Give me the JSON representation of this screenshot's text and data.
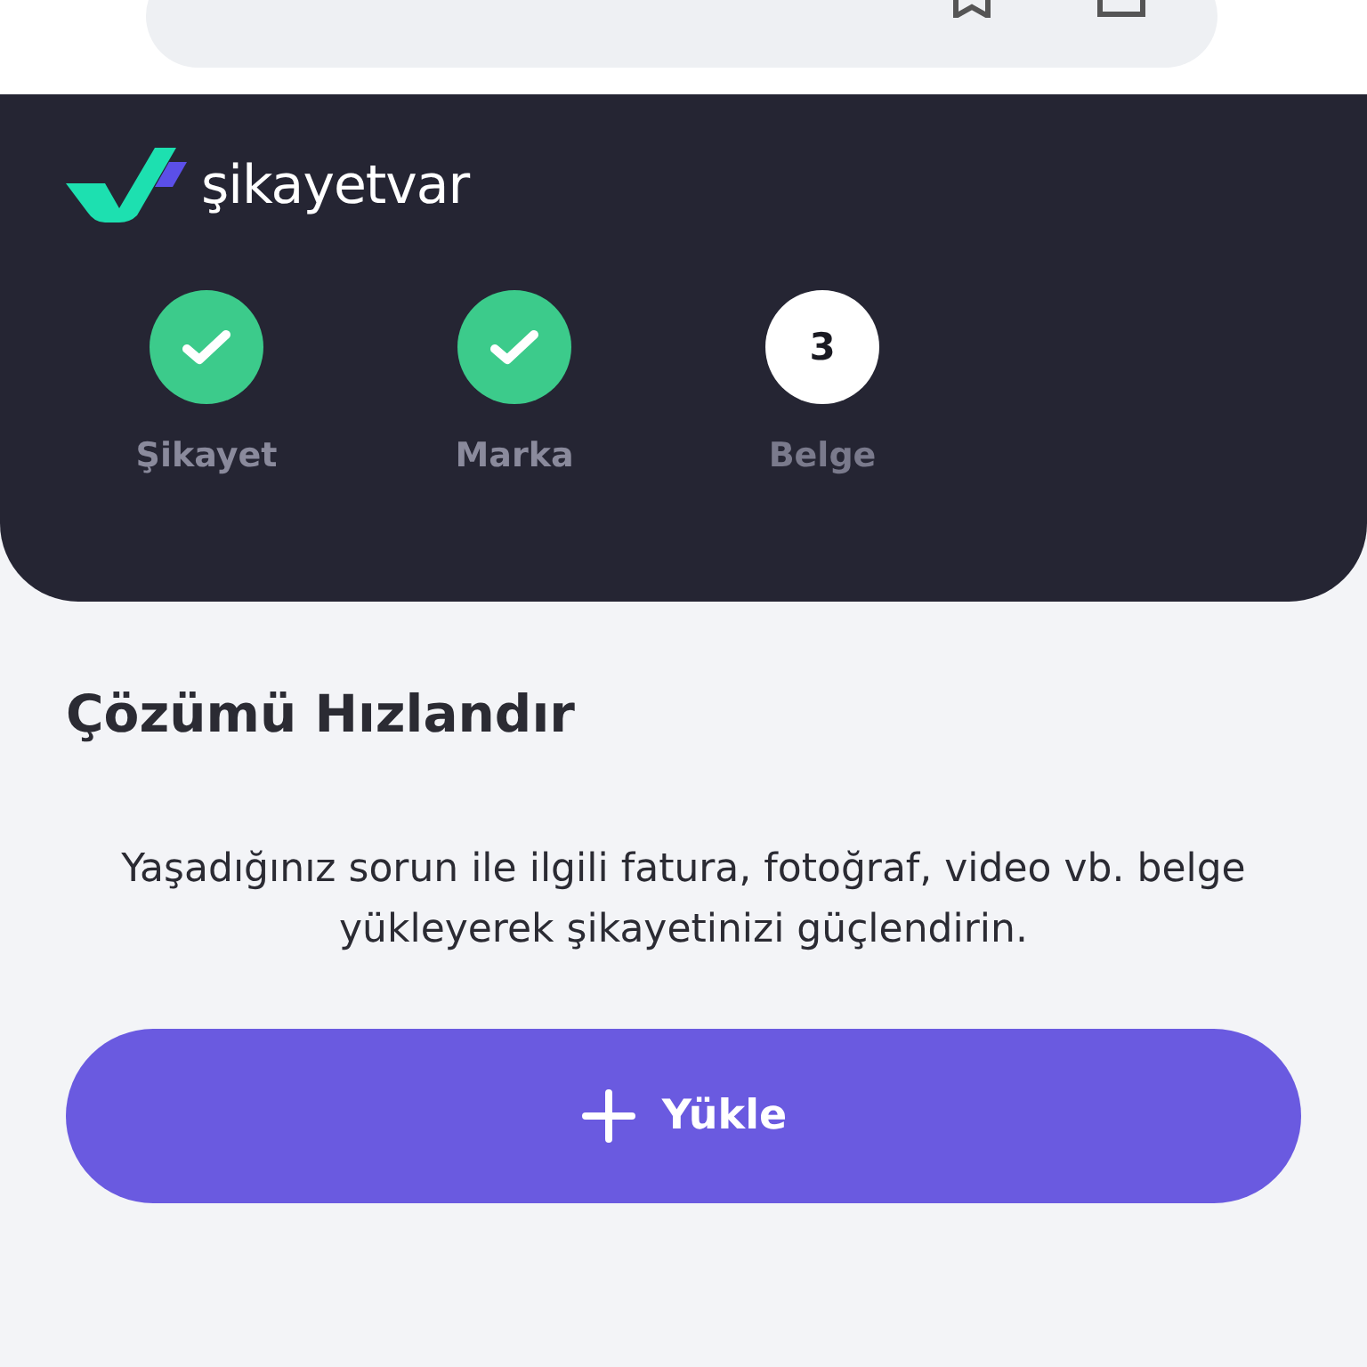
{
  "brand": {
    "name": "şikayetvar"
  },
  "steps": [
    {
      "label": "Şikayet",
      "completed": true
    },
    {
      "label": "Marka",
      "completed": true
    },
    {
      "label": "Belge",
      "completed": false,
      "number": "3"
    }
  ],
  "section": {
    "title": "Çözümü Hızlandır",
    "description": "Yaşadığınız sorun ile ilgili fatura, fotoğraf, video vb. belge yükleyerek şikayetinizi güçlendirin."
  },
  "upload_button": {
    "label": "Yükle"
  }
}
